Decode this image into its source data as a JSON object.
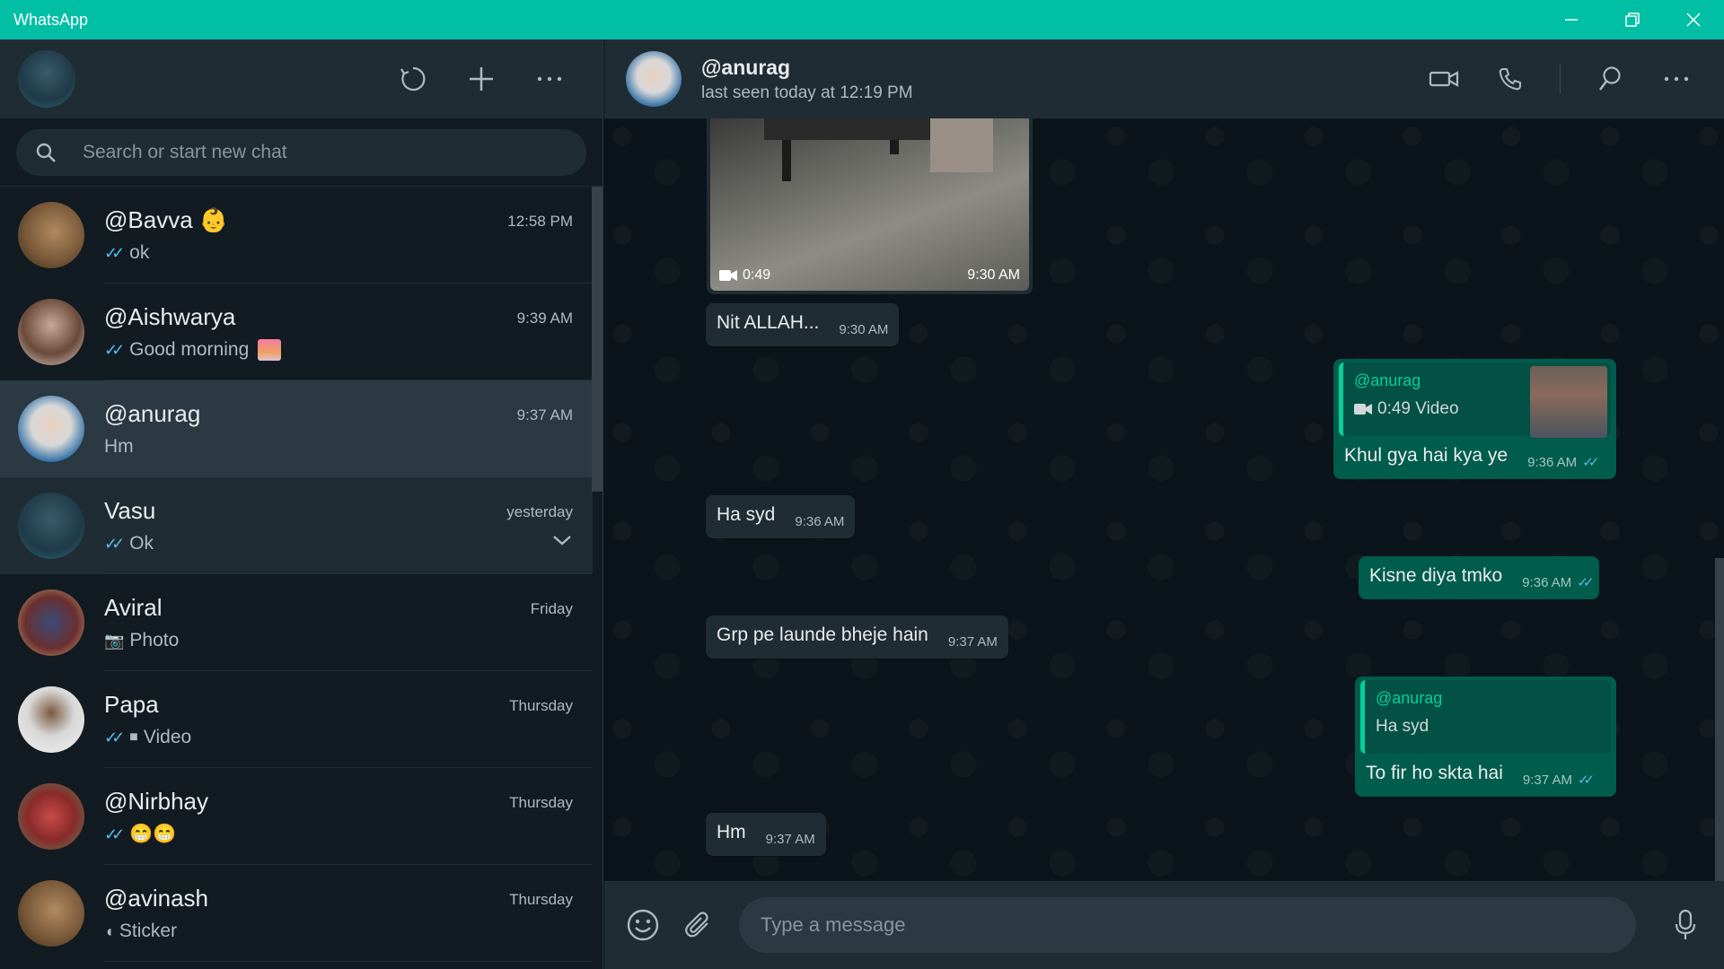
{
  "window": {
    "title": "WhatsApp"
  },
  "sidebar": {
    "search_placeholder": "Search or start new chat",
    "chats": [
      {
        "name": "@Bavva",
        "emoji": "👶",
        "time": "12:58 PM",
        "ticks": "✓✓",
        "preview": "ok",
        "avatar_color": "#8a6a50"
      },
      {
        "name": "@Aishwarya",
        "time": "9:39 AM",
        "ticks": "✓✓",
        "preview": "Good morning",
        "avatar_color": "#7a5a4a"
      },
      {
        "name": "@anurag",
        "time": "9:37 AM",
        "ticks": "",
        "preview": "Hm",
        "avatar_color": "#2b6ca3"
      },
      {
        "name": "Vasu",
        "time": "yesterday",
        "ticks": "✓✓",
        "preview": "Ok",
        "avatar_color": "#1f4d5c"
      },
      {
        "name": "Aviral",
        "time": "Friday",
        "ticks": "",
        "prefix_icon": "📷",
        "preview": "Photo",
        "avatar_color": "#6a3030"
      },
      {
        "name": "Papa",
        "time": "Thursday",
        "ticks": "✓✓",
        "prefix_icon": "■",
        "preview": "Video",
        "avatar_color": "#d8d8d8"
      },
      {
        "name": "@Nirbhay",
        "time": "Thursday",
        "ticks": "✓✓",
        "preview": "😁😁",
        "avatar_color": "#8a2a2a"
      },
      {
        "name": "@avinash",
        "time": "Thursday",
        "ticks": "",
        "prefix_icon": "◖",
        "preview": "Sticker",
        "avatar_color": "#8a6a50"
      }
    ]
  },
  "chat": {
    "contact_name": "@anurag",
    "last_seen": "last seen today at 12:19 PM",
    "messages": {
      "video": {
        "duration": "0:49",
        "time": "9:30 AM"
      },
      "m1": {
        "text": "Nit ALLAH...",
        "time": "9:30 AM"
      },
      "m2": {
        "quote_name": "@anurag",
        "quote_text": "0:49 Video",
        "text": "Khul gya hai kya ye",
        "time": "9:36 AM",
        "ticks": "✓✓"
      },
      "m3": {
        "text": "Ha syd",
        "time": "9:36 AM"
      },
      "m4": {
        "text": "Kisne diya tmko",
        "time": "9:36 AM",
        "ticks": "✓✓"
      },
      "m5": {
        "text": "Grp pe launde bheje hain",
        "time": "9:37 AM"
      },
      "m6": {
        "quote_name": "@anurag",
        "quote_text": "Ha syd",
        "text": "To fir ho skta hai",
        "time": "9:37 AM",
        "ticks": "✓✓"
      },
      "m7": {
        "text": "Hm",
        "time": "9:37 AM"
      }
    },
    "composer_placeholder": "Type a message"
  },
  "colors": {
    "accent": "#00bfa5",
    "outgoing": "#005c4b",
    "incoming": "#202c33",
    "tick": "#53bdeb"
  }
}
